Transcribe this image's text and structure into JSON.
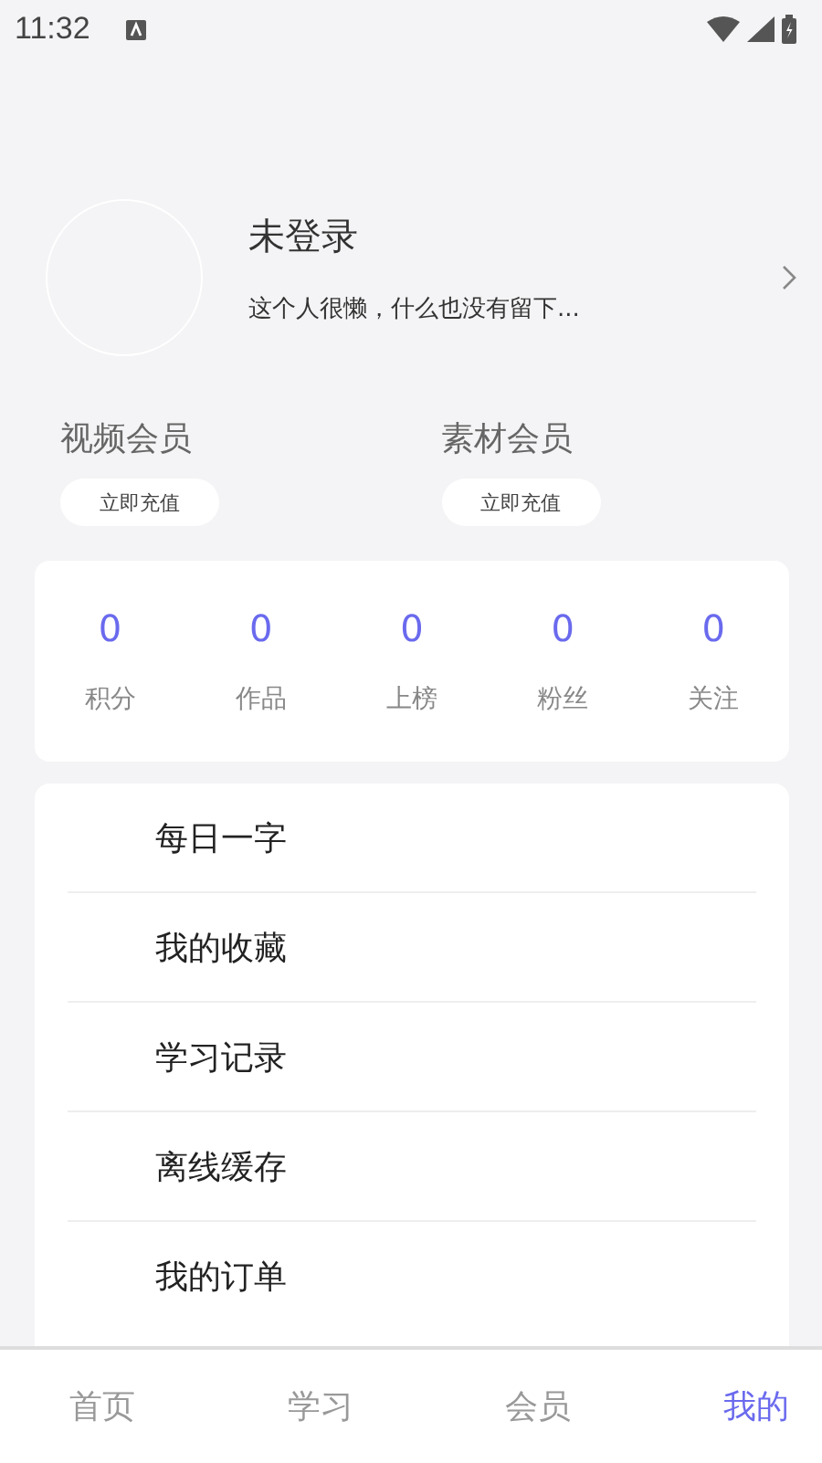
{
  "status_bar": {
    "time": "11:32"
  },
  "profile": {
    "name": "未登录",
    "bio": "这个人很懒，什么也没有留下..."
  },
  "memberships": [
    {
      "title": "视频会员",
      "button": "立即充值"
    },
    {
      "title": "素材会员",
      "button": "立即充值"
    }
  ],
  "stats": [
    {
      "value": "0",
      "label": "积分"
    },
    {
      "value": "0",
      "label": "作品"
    },
    {
      "value": "0",
      "label": "上榜"
    },
    {
      "value": "0",
      "label": "粉丝"
    },
    {
      "value": "0",
      "label": "关注"
    }
  ],
  "menu": [
    "每日一字",
    "我的收藏",
    "学习记录",
    "离线缓存",
    "我的订单"
  ],
  "tabs": [
    {
      "label": "首页",
      "selected": false
    },
    {
      "label": "学习",
      "selected": false
    },
    {
      "label": "会员",
      "selected": false
    },
    {
      "label": "我的",
      "selected": true
    }
  ]
}
